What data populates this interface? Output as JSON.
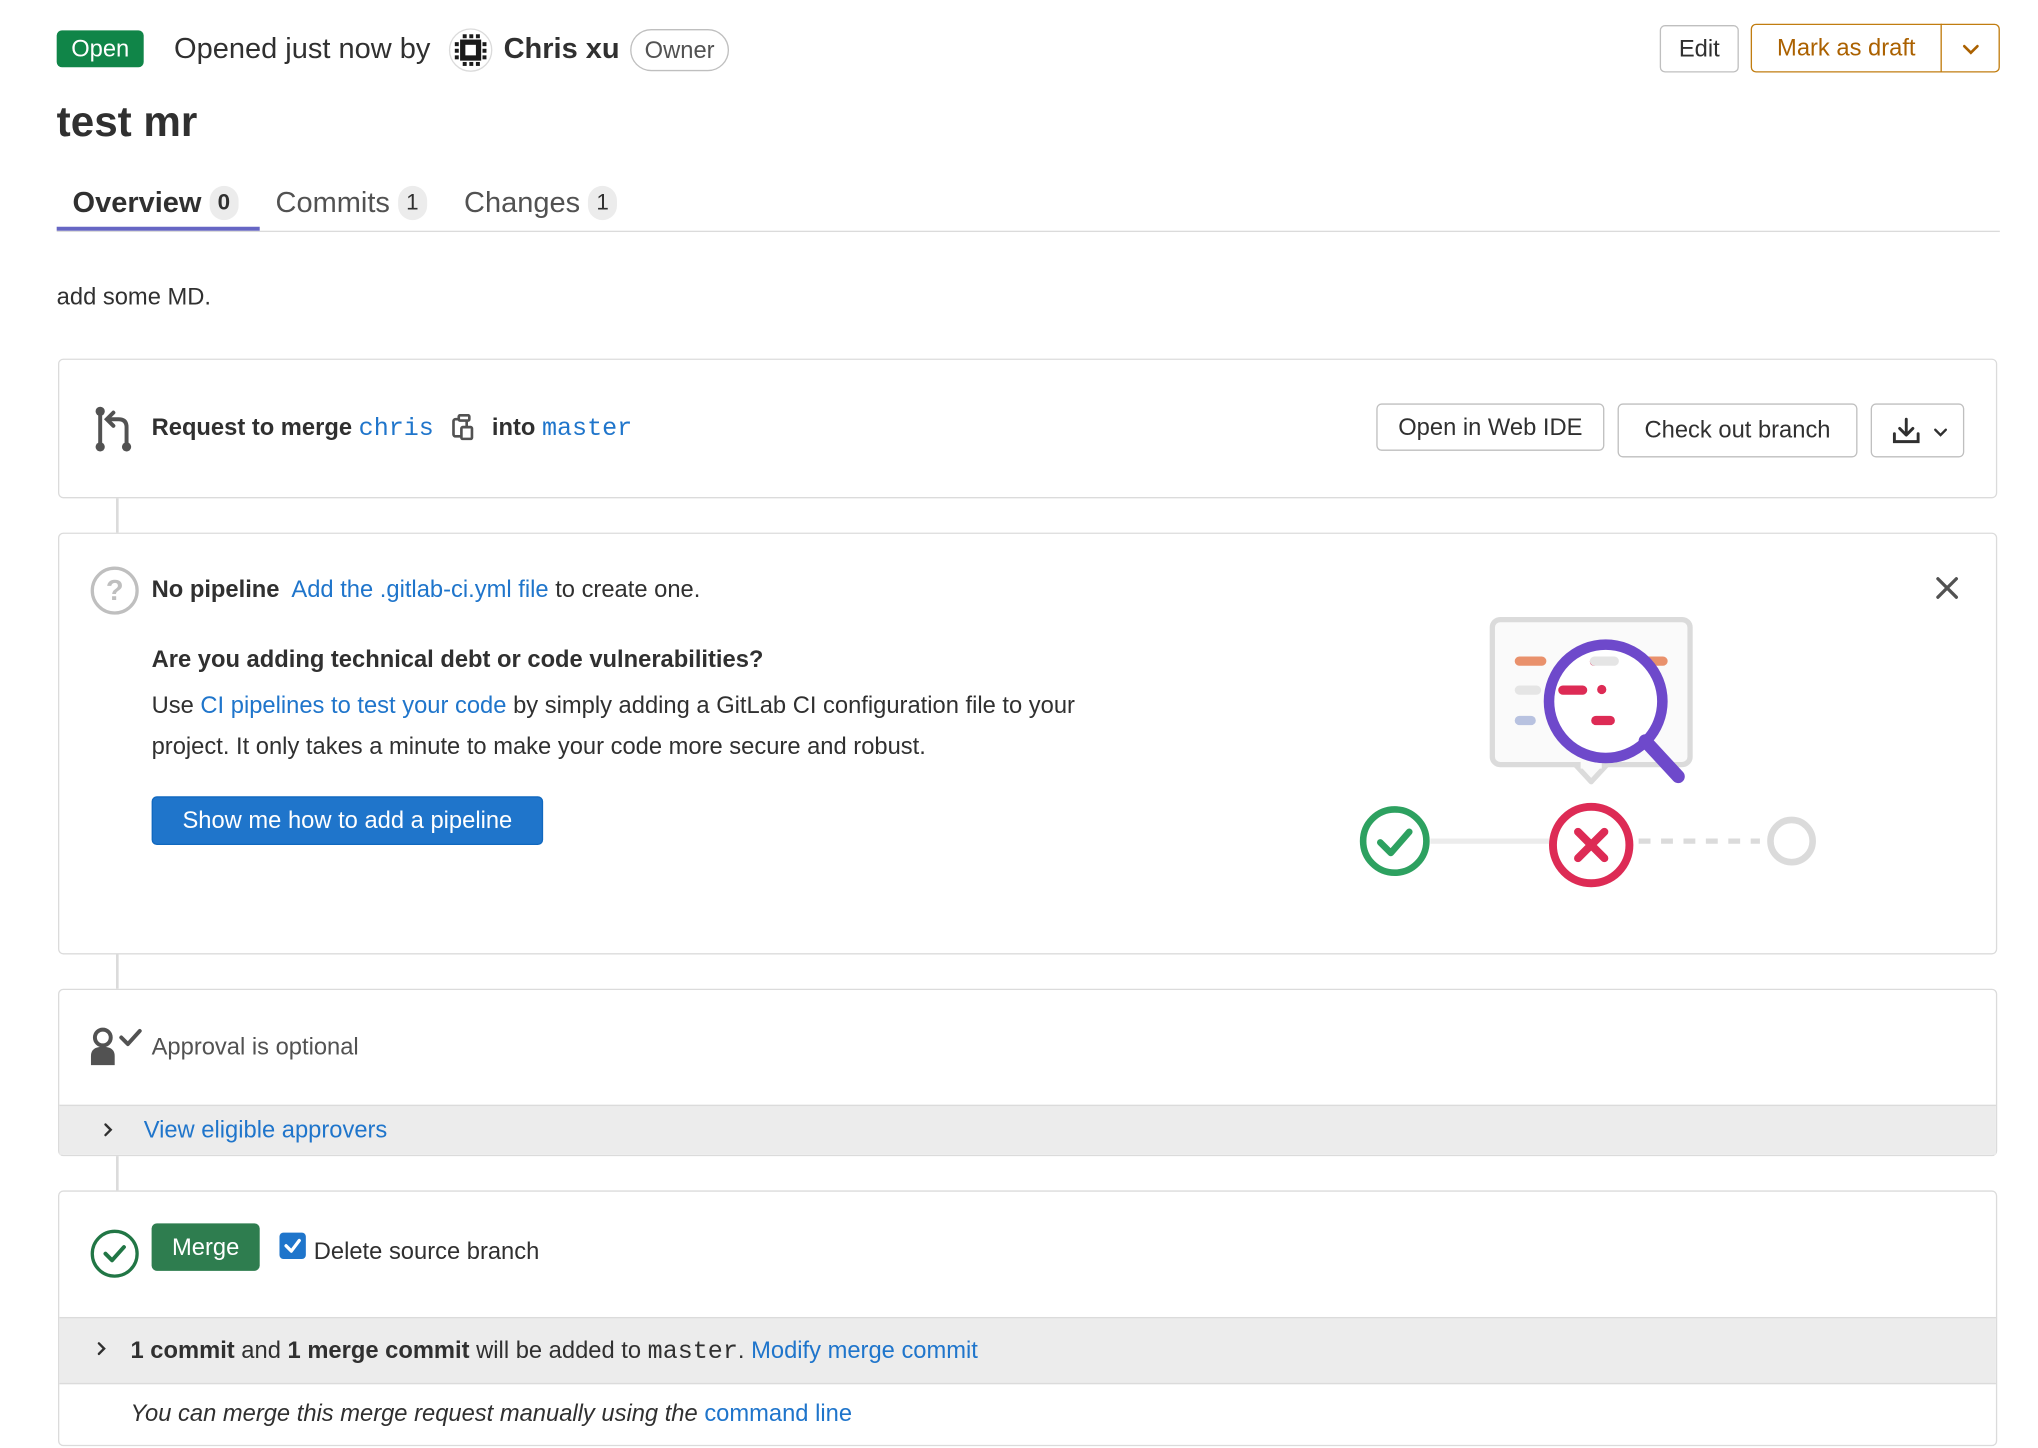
{
  "header": {
    "status_badge": "Open",
    "opened_text": "Opened just now by",
    "author_name": "Chris xu",
    "author_role": "Owner",
    "edit_label": "Edit",
    "mark_draft_label": "Mark as draft"
  },
  "title": "test mr",
  "tabs": [
    {
      "label": "Overview",
      "count": "0"
    },
    {
      "label": "Commits",
      "count": "1"
    },
    {
      "label": "Changes",
      "count": "1"
    }
  ],
  "description": "add some MD.",
  "merge_info": {
    "prefix": "Request to merge",
    "source_branch": "chris",
    "into": "into",
    "target_branch": "master",
    "web_ide_label": "Open in Web IDE",
    "checkout_label": "Check out branch"
  },
  "pipeline": {
    "no_pipeline": "No pipeline",
    "add_link": "Add the .gitlab-ci.yml file",
    "suffix": "to create one.",
    "heading": "Are you adding technical debt or code vulnerabilities?",
    "desc_prefix": "Use",
    "desc_link": "CI pipelines to test your code",
    "desc_suffix": "by simply adding a GitLab CI configuration file to your project. It only takes a minute to make your code more secure and robust.",
    "button_label": "Show me how to add a pipeline"
  },
  "approval": {
    "text": "Approval is optional",
    "link": "View eligible approvers"
  },
  "merge": {
    "button_label": "Merge",
    "delete_source_label": "Delete source branch",
    "delete_source_checked": true,
    "commit_count": "1 commit",
    "and": "and",
    "merge_commit_count": "1 merge commit",
    "will_be_added": "will be added to",
    "target_branch": "master",
    "modify_link": "Modify merge commit",
    "manual_text": "You can merge this merge request manually using the",
    "command_line_link": "command line"
  },
  "colors": {
    "open_badge": "#108548",
    "link": "#1f75cb",
    "draft_border": "#c17d10",
    "tab_underline": "#6666c4",
    "merge_button": "#2e7d4f",
    "primary_button": "#1f75cb"
  }
}
